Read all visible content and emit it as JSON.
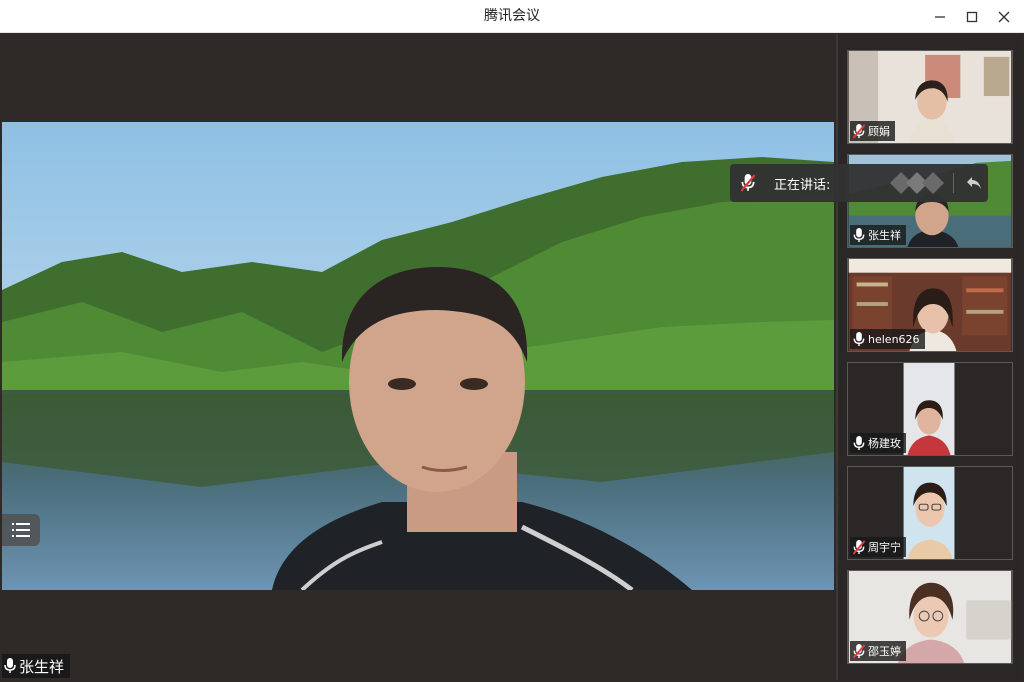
{
  "window": {
    "title": "腾讯会议"
  },
  "main": {
    "speaker_name": "张生祥"
  },
  "speaking_popup": {
    "label": "正在讲话:"
  },
  "participants": [
    {
      "name": "顾娟",
      "mic": "muted"
    },
    {
      "name": "张生祥",
      "mic": "on"
    },
    {
      "name": "helen626",
      "mic": "on"
    },
    {
      "name": "杨建玫",
      "mic": "on"
    },
    {
      "name": "周宇宁",
      "mic": "muted"
    },
    {
      "name": "邵玉婷",
      "mic": "muted"
    }
  ],
  "colors": {
    "muted_mic": "#e03c3c",
    "background": "#2f2a28"
  }
}
